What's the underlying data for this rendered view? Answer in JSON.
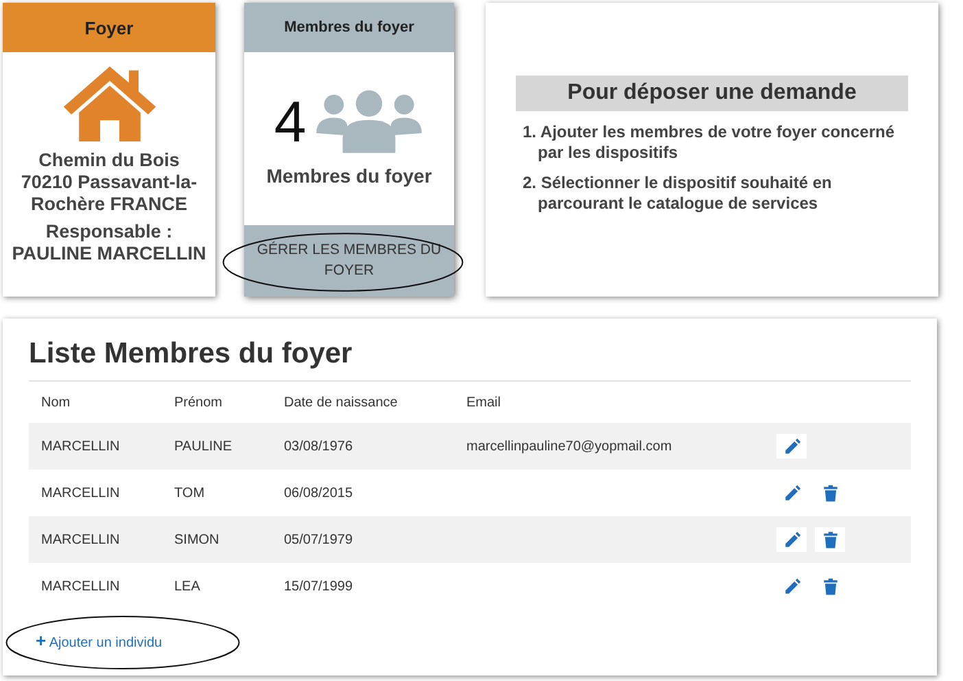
{
  "foyer_card": {
    "title": "Foyer",
    "address": [
      "Chemin du Bois",
      "70210 Passavant-la-",
      "Rochère FRANCE"
    ],
    "responsable_label": "Responsable :",
    "responsable_name": "PAULINE MARCELLIN"
  },
  "members_card": {
    "title": "Membres du foyer",
    "count": "4",
    "label": "Membres du foyer",
    "button": "GÉRER LES MEMBRES DU FOYER",
    "circled": true
  },
  "info_card": {
    "title": "Pour déposer une demande",
    "steps": [
      "1. Ajouter les membres de votre foyer concerné par les dispositifs",
      "2. Sélectionner le dispositif souhaité en parcourant le catalogue de services"
    ]
  },
  "members_list": {
    "title": "Liste Membres du foyer",
    "columns": [
      "Nom",
      "Prénom",
      "Date de naissance",
      "Email"
    ],
    "rows": [
      {
        "cells": [
          "MARCELLIN",
          "PAULINE",
          "03/08/1976",
          "marcellinpauline70@yopmail.com"
        ],
        "can_delete": false
      },
      {
        "cells": [
          "MARCELLIN",
          "TOM",
          "06/08/2015",
          ""
        ],
        "can_delete": true
      },
      {
        "cells": [
          "MARCELLIN",
          "SIMON",
          "05/07/1979",
          ""
        ],
        "can_delete": true
      },
      {
        "cells": [
          "MARCELLIN",
          "LEA",
          "15/07/1999",
          ""
        ],
        "can_delete": true
      }
    ],
    "add_link": {
      "icon": "+",
      "label": "Ajouter un individu",
      "circled": true
    }
  }
}
